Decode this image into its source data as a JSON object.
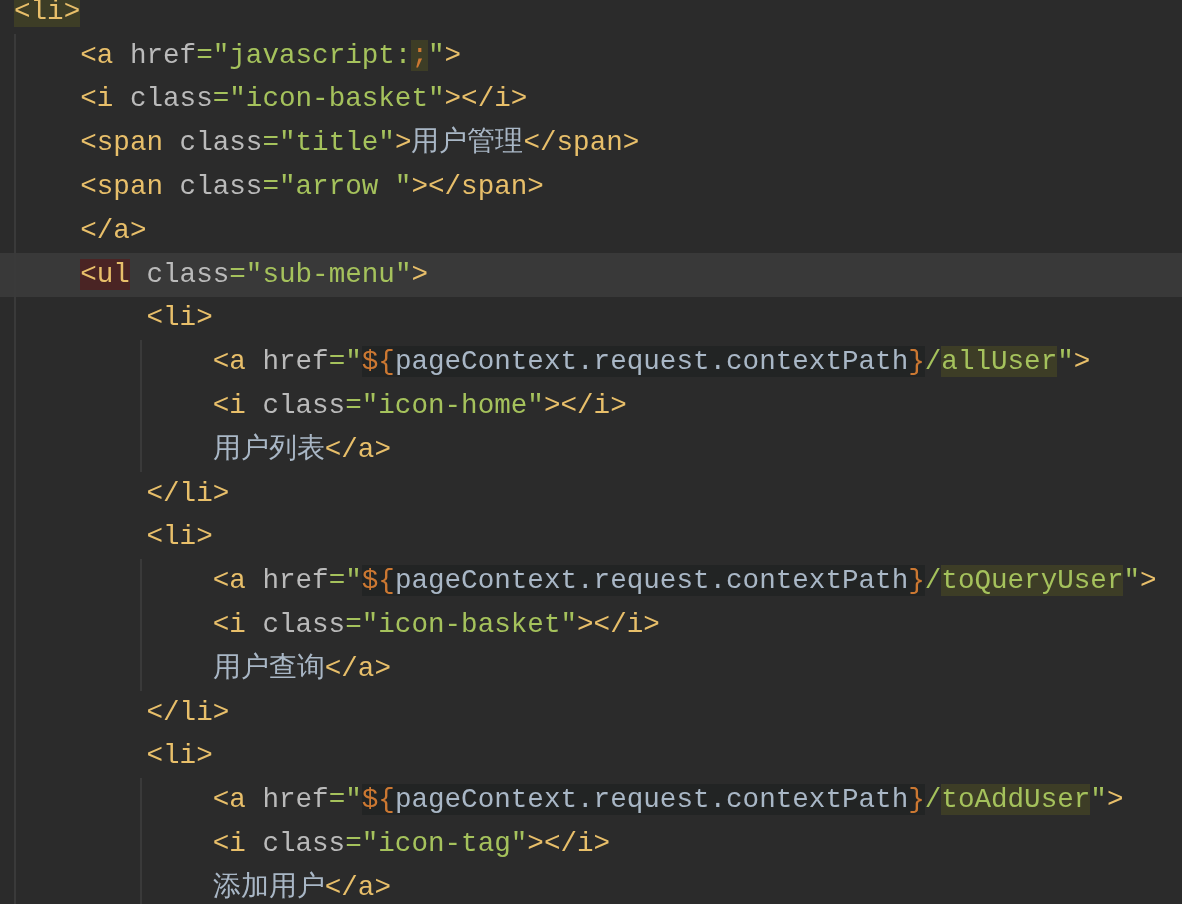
{
  "editor": {
    "lines": [
      {
        "current": false,
        "tokens": [
          {
            "text": "<li>",
            "kind": "tag",
            "matched": true
          }
        ]
      },
      {
        "current": false,
        "tokens": [
          {
            "text": "    <a",
            "kind": "tag"
          },
          {
            "text": " href",
            "kind": "attr"
          },
          {
            "text": "=\"javascript:",
            "kind": "str"
          },
          {
            "text": ";",
            "kind": "el",
            "matched": true
          },
          {
            "text": "\"",
            "kind": "str"
          },
          {
            "text": ">",
            "kind": "tag"
          }
        ]
      },
      {
        "current": false,
        "tokens": [
          {
            "text": "    <i",
            "kind": "tag"
          },
          {
            "text": " class",
            "kind": "attr"
          },
          {
            "text": "=\"icon-basket\"",
            "kind": "str"
          },
          {
            "text": "></i>",
            "kind": "tag"
          }
        ]
      },
      {
        "current": false,
        "tokens": [
          {
            "text": "    <span",
            "kind": "tag"
          },
          {
            "text": " class",
            "kind": "attr"
          },
          {
            "text": "=\"title\"",
            "kind": "str"
          },
          {
            "text": ">",
            "kind": "tag"
          },
          {
            "text": "用户管理",
            "kind": "text"
          },
          {
            "text": "</span>",
            "kind": "tag"
          }
        ]
      },
      {
        "current": false,
        "tokens": [
          {
            "text": "    <span",
            "kind": "tag"
          },
          {
            "text": " class",
            "kind": "attr"
          },
          {
            "text": "=\"arrow \"",
            "kind": "str"
          },
          {
            "text": "></span>",
            "kind": "tag"
          }
        ]
      },
      {
        "current": false,
        "tokens": [
          {
            "text": "    </a>",
            "kind": "tag"
          }
        ]
      },
      {
        "current": true,
        "tokens": [
          {
            "text": "    <ul",
            "kind": "tag",
            "unmatched": true
          },
          {
            "text": " class",
            "kind": "attr"
          },
          {
            "text": "=\"sub-menu\"",
            "kind": "str"
          },
          {
            "text": ">",
            "kind": "tag"
          }
        ]
      },
      {
        "current": false,
        "tokens": [
          {
            "text": "        <li>",
            "kind": "tag"
          }
        ]
      },
      {
        "current": false,
        "tokens": [
          {
            "text": "            <a",
            "kind": "tag"
          },
          {
            "text": " href",
            "kind": "attr"
          },
          {
            "text": "=\"",
            "kind": "str"
          },
          {
            "text": "${",
            "kind": "el",
            "injected": true
          },
          {
            "text": "pageContext.request.contextPath",
            "kind": "expr",
            "injected": true
          },
          {
            "text": "}",
            "kind": "el",
            "injected": true
          },
          {
            "text": "/",
            "kind": "str"
          },
          {
            "text": "allUser",
            "kind": "str",
            "matched": true
          },
          {
            "text": "\"",
            "kind": "str"
          },
          {
            "text": ">",
            "kind": "tag"
          }
        ]
      },
      {
        "current": false,
        "tokens": [
          {
            "text": "            <i",
            "kind": "tag"
          },
          {
            "text": " class",
            "kind": "attr"
          },
          {
            "text": "=\"icon-home\"",
            "kind": "str"
          },
          {
            "text": "></i>",
            "kind": "tag"
          }
        ]
      },
      {
        "current": false,
        "tokens": [
          {
            "text": "            用户列表",
            "kind": "text"
          },
          {
            "text": "</a>",
            "kind": "tag"
          }
        ]
      },
      {
        "current": false,
        "tokens": [
          {
            "text": "        </li>",
            "kind": "tag"
          }
        ]
      },
      {
        "current": false,
        "tokens": [
          {
            "text": "        <li>",
            "kind": "tag"
          }
        ]
      },
      {
        "current": false,
        "tokens": [
          {
            "text": "            <a",
            "kind": "tag"
          },
          {
            "text": " href",
            "kind": "attr"
          },
          {
            "text": "=\"",
            "kind": "str"
          },
          {
            "text": "${",
            "kind": "el",
            "injected": true
          },
          {
            "text": "pageContext.request.contextPath",
            "kind": "expr",
            "injected": true
          },
          {
            "text": "}",
            "kind": "el",
            "injected": true
          },
          {
            "text": "/",
            "kind": "str"
          },
          {
            "text": "toQueryUser",
            "kind": "str",
            "matched": true
          },
          {
            "text": "\"",
            "kind": "str"
          },
          {
            "text": ">",
            "kind": "tag"
          }
        ]
      },
      {
        "current": false,
        "tokens": [
          {
            "text": "            <i",
            "kind": "tag"
          },
          {
            "text": " class",
            "kind": "attr"
          },
          {
            "text": "=\"icon-basket\"",
            "kind": "str"
          },
          {
            "text": "></i>",
            "kind": "tag"
          }
        ]
      },
      {
        "current": false,
        "tokens": [
          {
            "text": "            用户查询",
            "kind": "text"
          },
          {
            "text": "</a>",
            "kind": "tag"
          }
        ]
      },
      {
        "current": false,
        "tokens": [
          {
            "text": "        </li>",
            "kind": "tag"
          }
        ]
      },
      {
        "current": false,
        "tokens": [
          {
            "text": "        <li>",
            "kind": "tag"
          }
        ]
      },
      {
        "current": false,
        "tokens": [
          {
            "text": "            <a",
            "kind": "tag"
          },
          {
            "text": " href",
            "kind": "attr"
          },
          {
            "text": "=\"",
            "kind": "str"
          },
          {
            "text": "${",
            "kind": "el",
            "injected": true
          },
          {
            "text": "pageContext.request.contextPath",
            "kind": "expr",
            "injected": true
          },
          {
            "text": "}",
            "kind": "el",
            "injected": true
          },
          {
            "text": "/",
            "kind": "str"
          },
          {
            "text": "toAddUser",
            "kind": "str",
            "matched": true
          },
          {
            "text": "\"",
            "kind": "str"
          },
          {
            "text": ">",
            "kind": "tag"
          }
        ]
      },
      {
        "current": false,
        "tokens": [
          {
            "text": "            <i",
            "kind": "tag"
          },
          {
            "text": " class",
            "kind": "attr"
          },
          {
            "text": "=\"icon-tag\"",
            "kind": "str"
          },
          {
            "text": "></i>",
            "kind": "tag"
          }
        ]
      },
      {
        "current": false,
        "tokens": [
          {
            "text": "            添加用户",
            "kind": "text"
          },
          {
            "text": "</a>",
            "kind": "tag"
          }
        ]
      }
    ]
  }
}
